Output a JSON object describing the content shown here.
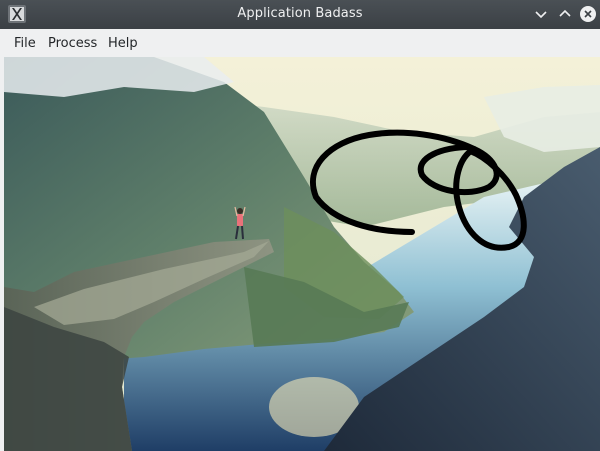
{
  "window": {
    "title": "Application Badass",
    "app_icon": "x-logo-icon",
    "controls": [
      "minimize-icon",
      "maximize-icon",
      "close-icon"
    ]
  },
  "menubar": {
    "items": [
      {
        "label": "File"
      },
      {
        "label": "Process"
      },
      {
        "label": "Help"
      }
    ]
  },
  "canvas": {
    "image_subject": "fjord landscape with a person standing on a rock ledge",
    "stroke_color": "#000000"
  },
  "colors": {
    "titlebar": "#3b4045",
    "menubar": "#eff0f1",
    "text": "#232629"
  }
}
